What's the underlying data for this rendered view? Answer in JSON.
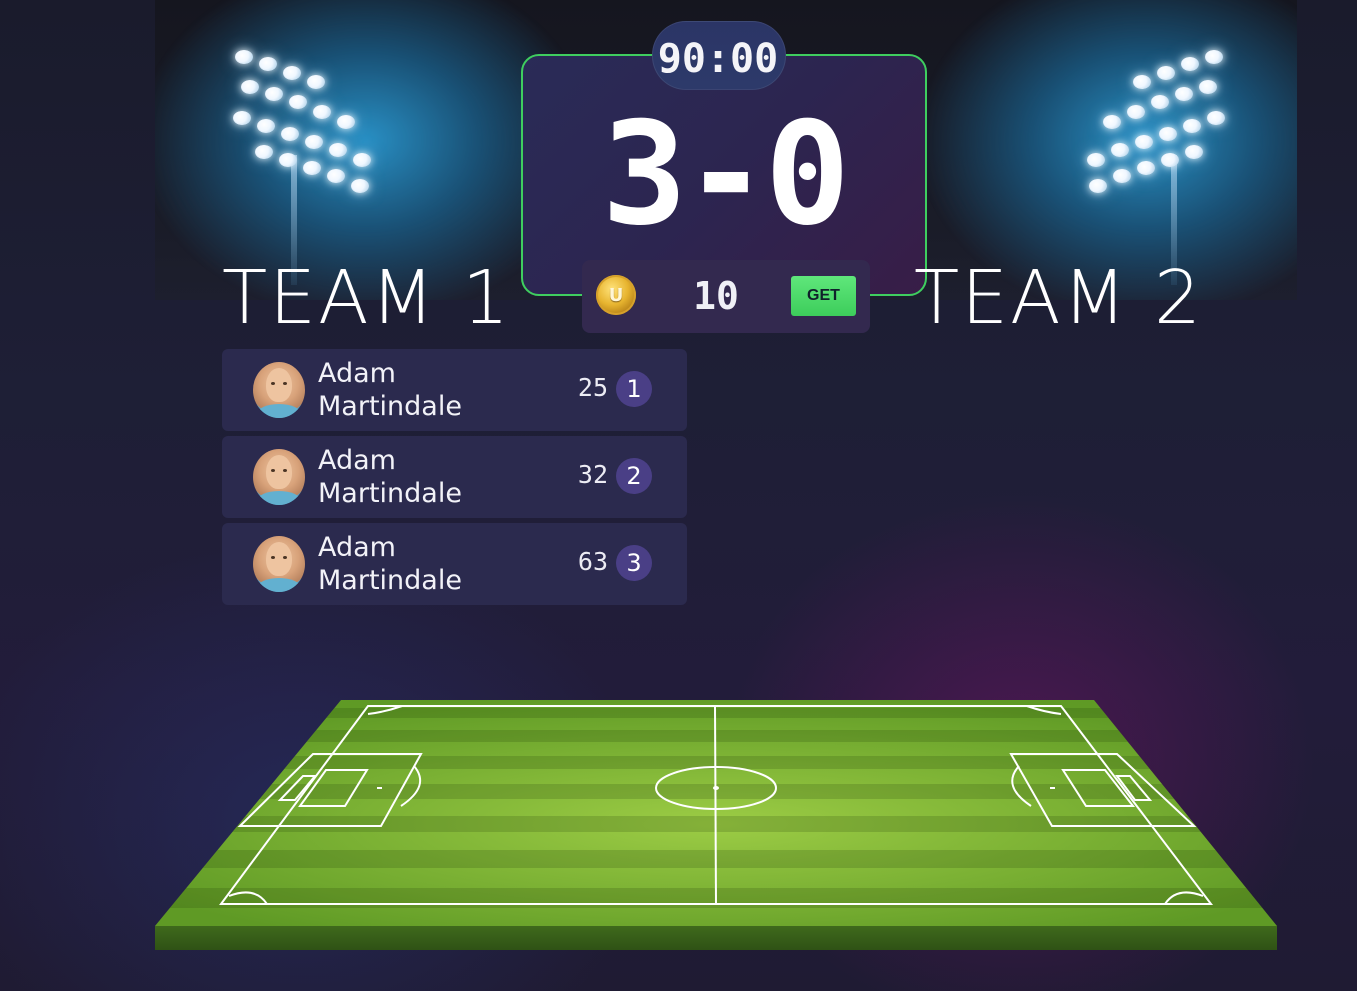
{
  "match": {
    "timer": "90:00",
    "score": "3-0",
    "team1_name": "TEAM 1",
    "team2_name": "TEAM 2"
  },
  "coins": {
    "icon_letter": "U",
    "count": "10",
    "get_label": "GET"
  },
  "players": [
    {
      "first_name": "Adam",
      "last_name": "Martindale",
      "score": "25",
      "rank": "1"
    },
    {
      "first_name": "Adam",
      "last_name": "Martindale",
      "score": "32",
      "rank": "2"
    },
    {
      "first_name": "Adam",
      "last_name": "Martindale",
      "score": "63",
      "rank": "3"
    }
  ],
  "colors": {
    "scoreboard_border": "#3fce5f",
    "get_button": "#4fdc6c",
    "rank_badge": "#4a3f86",
    "floodlight_glow": "#2a96cd",
    "pitch_green": "#6aa82f"
  },
  "icons": [
    "floodlight-icon",
    "coin-icon",
    "player-avatar",
    "football-pitch"
  ]
}
